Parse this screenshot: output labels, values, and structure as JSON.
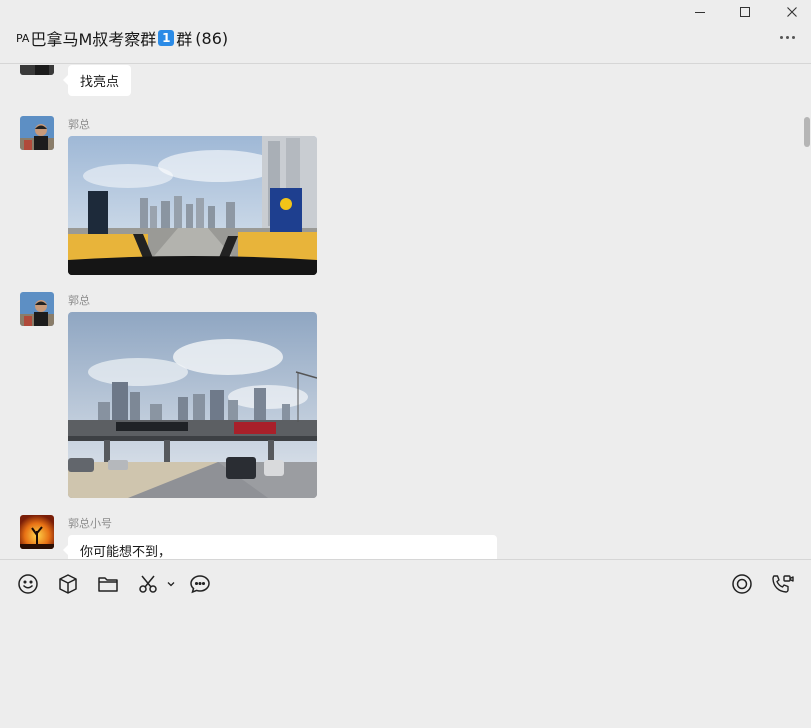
{
  "window": {
    "title_prefix": "PA",
    "title_main": "巴拿马M叔考察群",
    "title_badge": "1",
    "title_group": "群",
    "member_count": "(86)",
    "controls": [
      "minimize-icon",
      "maximize-icon",
      "close-icon"
    ]
  },
  "messages": [
    {
      "type": "text",
      "sender": "",
      "text": "找亮点"
    },
    {
      "type": "image",
      "sender": "郭总",
      "image": "road-checkpoint-city-skyline-photo"
    },
    {
      "type": "image",
      "sender": "郭总",
      "image": "highway-bridge-city-skyline-photo"
    },
    {
      "type": "text",
      "sender": "郭总小号",
      "text": "你可能想不到，"
    }
  ],
  "toolbar": {
    "left_icons": [
      "emoji-icon",
      "package-icon",
      "folder-icon",
      "scissors-icon",
      "chevron-down-icon",
      "chat-bubble-icon"
    ],
    "right_icons": [
      "live-icon",
      "call-icon"
    ]
  },
  "colors": {
    "background": "#ededed",
    "bubble": "#ffffff",
    "badge": "#2b8be6",
    "muted_text": "#8c8c8c"
  }
}
